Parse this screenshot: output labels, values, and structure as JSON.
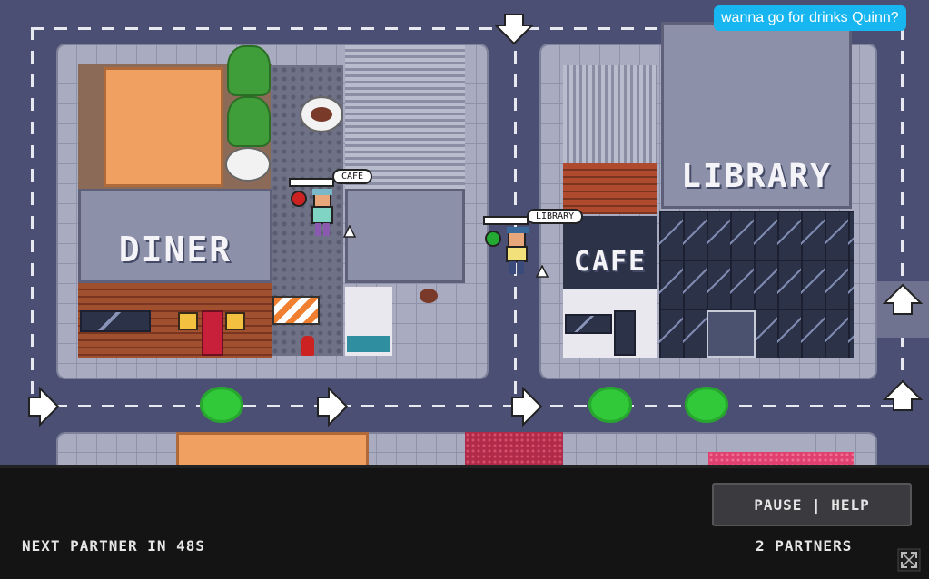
{
  "chat": {
    "message": "wanna go for drinks Quinn?"
  },
  "buildings": {
    "diner": "DINER",
    "cafe": "CAFE",
    "library": "LIBRARY"
  },
  "players": [
    {
      "bubble": "CAFE",
      "status": "red"
    },
    {
      "bubble": "LIBRARY",
      "status": "green"
    }
  ],
  "hud": {
    "countdown": "NEXT PARTNER IN 48S",
    "partners": "2 PARTNERS",
    "pause_help": "PAUSE | HELP"
  },
  "colors": {
    "road": "#4b4f73",
    "sidewalk": "#a9acc0",
    "chat_bg": "#17b6f0",
    "marker_green": "#31c83a",
    "status_red": "#cc2222",
    "status_green": "#22aa33"
  },
  "icons": [
    "arrow-down-icon",
    "arrow-right-icon",
    "arrow-up-icon",
    "fullscreen-icon"
  ]
}
